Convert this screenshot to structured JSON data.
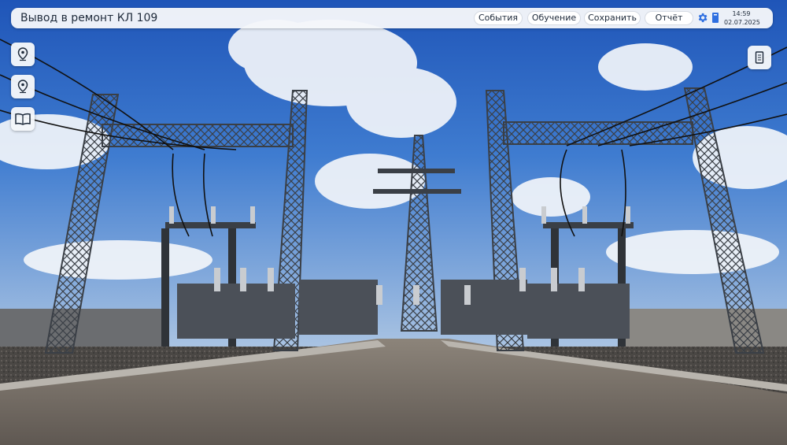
{
  "app": {
    "title": "Вывод в ремонт КЛ 109"
  },
  "toolbar": {
    "events_label": "События",
    "training_label": "Обучение",
    "save_label": "Сохранить",
    "report_label": "Отчёт",
    "settings_icon": "gear-icon",
    "book_icon": "book-icon"
  },
  "clock": {
    "time": "14:59",
    "date": "02.07.2025"
  },
  "sidebar": {
    "items": [
      {
        "icon": "map-pin-icon"
      },
      {
        "icon": "map-pin-icon"
      },
      {
        "icon": "open-book-icon"
      }
    ],
    "right_item": {
      "icon": "notebook-icon"
    }
  },
  "colors": {
    "accent": "#2f6fe0",
    "sky_top": "#1f55b8",
    "sky_bottom": "#8fb3dc",
    "steel": "#3a3f46",
    "road": "#6e655c"
  }
}
